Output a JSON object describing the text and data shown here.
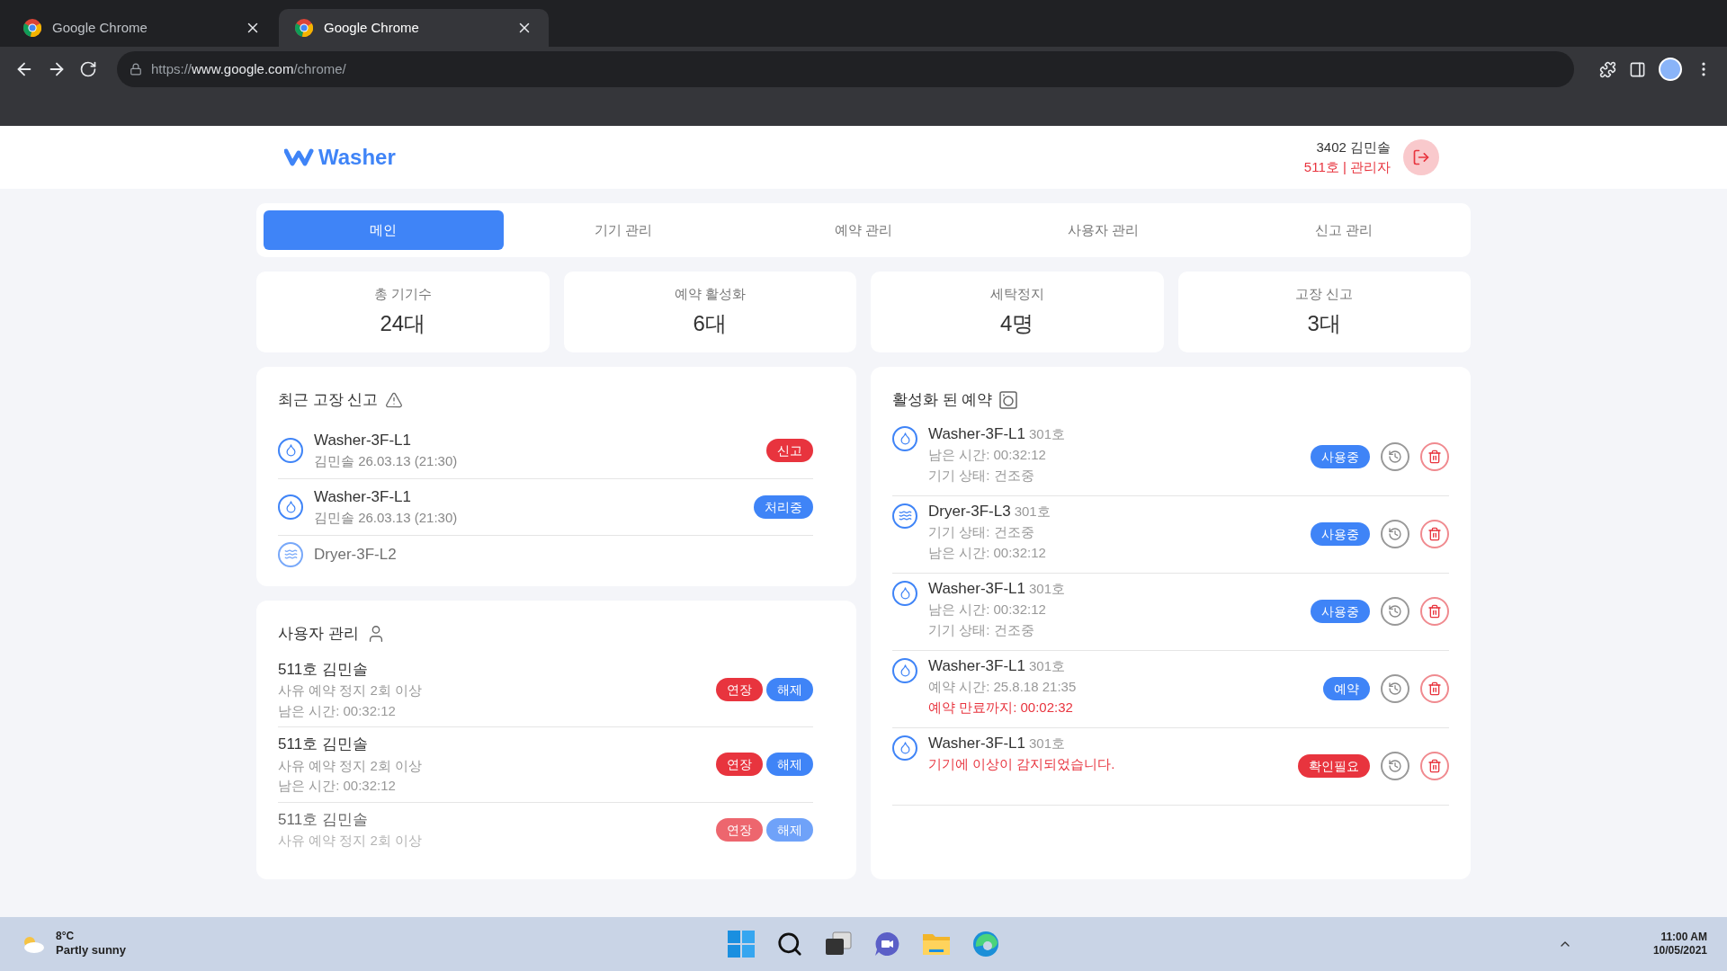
{
  "browser": {
    "tabs": [
      {
        "title": "Google Chrome",
        "selected": false
      },
      {
        "title": "Google Chrome",
        "selected": true
      }
    ],
    "url": {
      "scheme": "https://",
      "host": "www.google.com",
      "path": "/chrome/"
    }
  },
  "header": {
    "logo": "Washer",
    "user_name": "3402 김민솔",
    "user_role": "511호 | 관리자"
  },
  "nav": [
    {
      "label": "메인",
      "selected": true
    },
    {
      "label": "기기 관리",
      "selected": false
    },
    {
      "label": "예약 관리",
      "selected": false
    },
    {
      "label": "사용자 관리",
      "selected": false
    },
    {
      "label": "신고 관리",
      "selected": false
    }
  ],
  "stats": [
    {
      "label": "총 기기수",
      "value": "24대"
    },
    {
      "label": "예약 활성화",
      "value": "6대"
    },
    {
      "label": "세탁정지",
      "value": "4명"
    },
    {
      "label": "고장 신고",
      "value": "3대"
    }
  ],
  "reports": {
    "title": "최근 고장 신고",
    "items": [
      {
        "kind": "washer",
        "device": "Washer-3F-L1",
        "meta": "김민솔 26.03.13 (21:30)",
        "status": "신고",
        "color": "#e8343e",
        "faded": false
      },
      {
        "kind": "washer",
        "device": "Washer-3F-L1",
        "meta": "김민솔 26.03.13 (21:30)",
        "status": "처리중",
        "color": "#3f84f7",
        "faded": false
      },
      {
        "kind": "dryer",
        "device": "Dryer-3F-L2",
        "faded": true
      }
    ]
  },
  "users": {
    "title": "사용자 관리",
    "items": [
      {
        "name": "511호 김민솔",
        "reason": "사유 예약 정지 2회 이상",
        "remaining": "남은 시간: 00:32:12",
        "actions": [
          "연장",
          "해제"
        ],
        "faded": false
      },
      {
        "name": "511호 김민솔",
        "reason": "사유 예약 정지 2회 이상",
        "remaining": "남은 시간: 00:32:12",
        "actions": [
          "연장",
          "해제"
        ],
        "faded": false
      },
      {
        "name": "511호 김민솔",
        "reason": "사유 예약 정지 2회 이상",
        "actions": [
          "연장",
          "해제"
        ],
        "faded": true
      }
    ]
  },
  "reservations": {
    "title": "활성화 된 예약",
    "items": [
      {
        "kind": "washer",
        "device": "Washer-3F-L1",
        "room": "301호",
        "lines": [
          {
            "text": "남은 시간: 00:32:12",
            "alert": false
          },
          {
            "text": "기기 상태: 건조중",
            "alert": false
          }
        ],
        "status": "사용중",
        "color": "#3f84f7"
      },
      {
        "kind": "dryer",
        "device": "Dryer-3F-L3",
        "room": "301호",
        "lines": [
          {
            "text": "기기 상태: 건조중",
            "alert": false
          },
          {
            "text": "남은 시간: 00:32:12",
            "alert": false
          }
        ],
        "status": "사용중",
        "color": "#3f84f7"
      },
      {
        "kind": "washer",
        "device": "Washer-3F-L1",
        "room": "301호",
        "lines": [
          {
            "text": "남은 시간: 00:32:12",
            "alert": false
          },
          {
            "text": "기기 상태: 건조중",
            "alert": false
          }
        ],
        "status": "사용중",
        "color": "#3f84f7"
      },
      {
        "kind": "washer",
        "device": "Washer-3F-L1",
        "room": "301호",
        "lines": [
          {
            "text": "예약 시간: 25.8.18 21:35",
            "alert": false
          },
          {
            "text": "예약 만료까지: 00:02:32",
            "alert": true
          }
        ],
        "status": "예약",
        "color": "#3f84f7"
      },
      {
        "kind": "washer",
        "device": "Washer-3F-L1",
        "room": "301호",
        "lines": [
          {
            "text": "기기에 이상이 감지되었습니다.",
            "alert": true
          }
        ],
        "status": "확인필요",
        "color": "#e8343e"
      }
    ]
  },
  "taskbar": {
    "temperature": "8°C",
    "weather": "Partly sunny",
    "time": "11:00 AM",
    "date": "10/05/2021"
  }
}
